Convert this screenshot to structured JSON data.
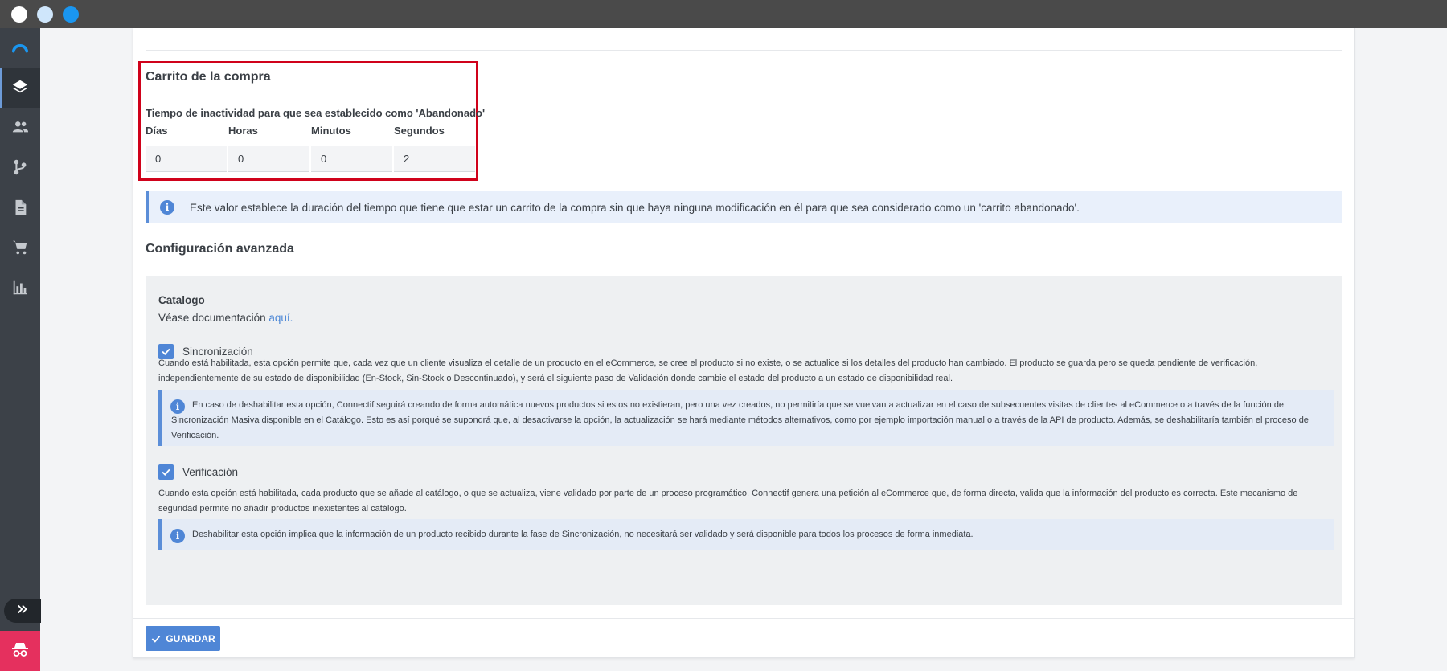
{
  "sidebar": {
    "items": [
      {
        "icon": "logo-icon"
      },
      {
        "icon": "layers-icon",
        "active": true
      },
      {
        "icon": "users-icon"
      },
      {
        "icon": "git-branch-icon"
      },
      {
        "icon": "document-icon"
      },
      {
        "icon": "cart-icon"
      },
      {
        "icon": "bar-chart-icon"
      }
    ],
    "expand_icon": "double-chevron-right-icon",
    "bottom_icon": "incognito-icon"
  },
  "cart": {
    "title": "Carrito de la compra",
    "inactivity_label": "Tiempo de inactividad para que sea establecido como 'Abandonado'",
    "fields": [
      {
        "label": "Días",
        "value": "0"
      },
      {
        "label": "Horas",
        "value": "0"
      },
      {
        "label": "Minutos",
        "value": "0"
      },
      {
        "label": "Segundos",
        "value": "2"
      }
    ],
    "info": "Este valor establece la duración del tiempo que tiene que estar un carrito de la compra sin que haya ninguna modificación en él para que sea considerado como un 'carrito abandonado'."
  },
  "advanced": {
    "title": "Configuración avanzada",
    "catalog_title": "Catalogo",
    "doc_prefix": "Véase documentación ",
    "doc_link": "aquí.",
    "sync": {
      "label": "Sincronización",
      "checked": true,
      "description": "Cuando está habilitada, esta opción permite que, cada vez que un cliente visualiza el detalle de un producto en el eCommerce, se cree el producto si no existe, o se actualice si los detalles del producto han cambiado. El producto se guarda pero se queda pendiente de verificación, independientemente de su estado de disponibilidad (En-Stock, Sin-Stock o Descontinuado), y será el siguiente paso de Validación donde cambie el estado del producto a un estado de disponibilidad real.",
      "info": "En caso de deshabilitar esta opción, Connectif seguirá creando de forma automática nuevos productos si estos no existieran, pero una vez creados, no permitiría que se vuelvan a actualizar en el caso de subsecuentes visitas de clientes al eCommerce o a través de la función de Sincronización Masiva disponible en el Catálogo. Esto es así porqué se supondrá que, al desactivarse la opción, la actualización se hará mediante métodos alternativos, como por ejemplo importación manual o a través de la API de producto. Además, se deshabilitaría también el proceso de Verificación."
    },
    "verify": {
      "label": "Verificación",
      "checked": true,
      "description": "Cuando esta opción está habilitada, cada producto que se añade al catálogo, o que se actualiza, viene validado por parte de un proceso programático. Connectif genera una petición al eCommerce que, de forma directa, valida que la información del producto es correcta. Este mecanismo de seguridad permite no añadir productos inexistentes al catálogo.",
      "info": "Deshabilitar esta opción implica que la información de un producto recibido durante la fase de Sincronización, no necesitará ser validado y será disponible para todos los procesos de forma inmediata."
    }
  },
  "save_label": "GUARDAR",
  "colors": {
    "accent": "#4f86d6",
    "highlight": "#d0021b",
    "sidebar": "#3c4148",
    "incognito": "#e5305e"
  }
}
